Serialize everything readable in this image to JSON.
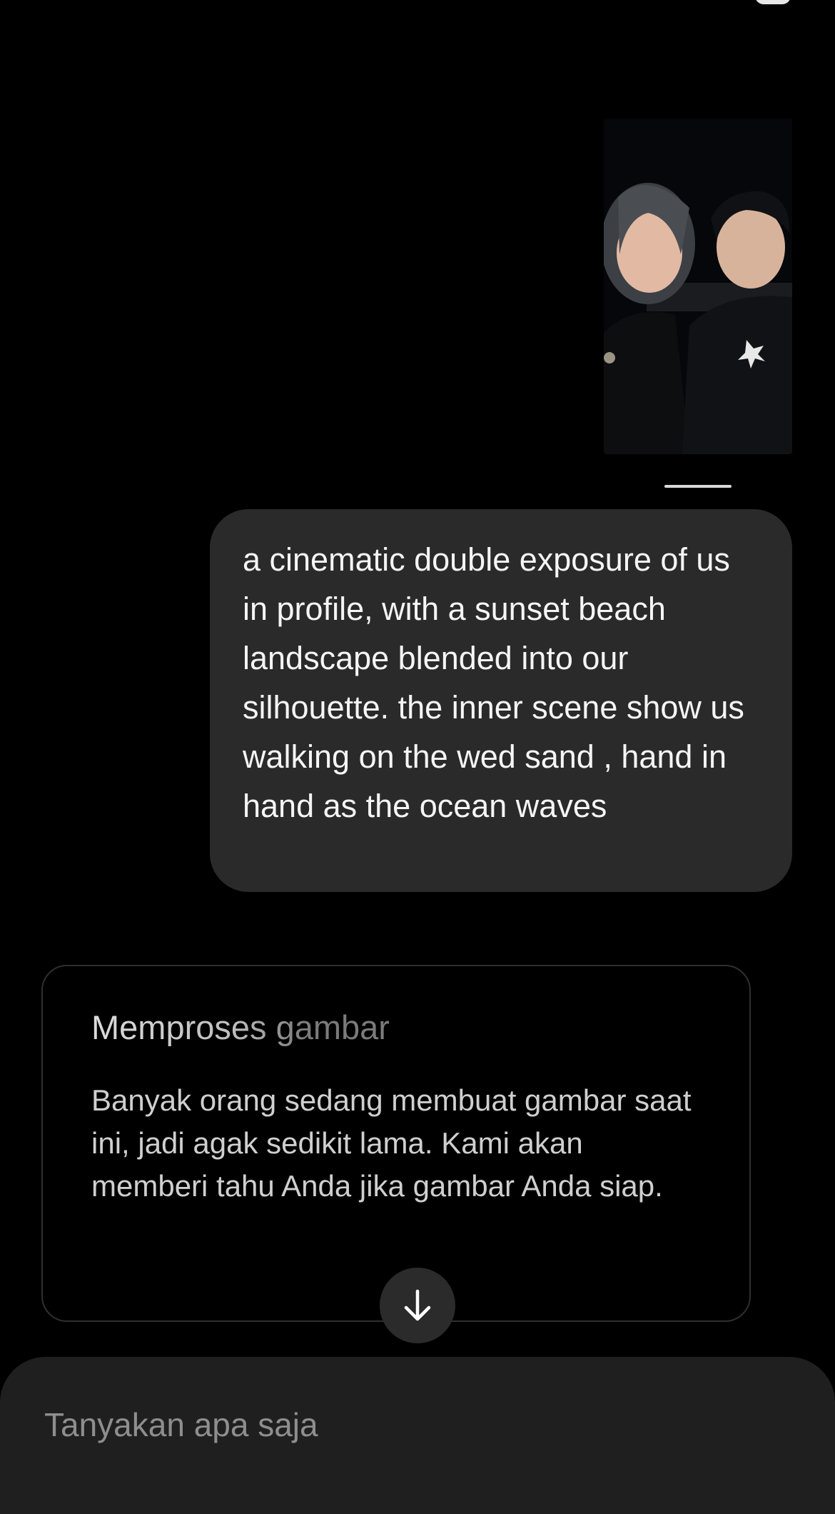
{
  "attachment": {
    "icon": "photo-thumbnail"
  },
  "message": {
    "text": "a cinematic double exposure of us in profile, with a sunset beach landscape blended into our silhouette. the inner scene show us walking on the wed sand , hand in hand as the ocean waves"
  },
  "processing": {
    "title": "Memproses gambar",
    "body": "Banyak orang sedang membuat gambar saat ini, jadi agak sedikit lama. Kami akan memberi tahu Anda jika gambar Anda siap."
  },
  "scroll_button": {
    "icon": "arrow-down-icon"
  },
  "composer": {
    "placeholder": "Tanyakan apa saja"
  },
  "colors": {
    "background": "#000000",
    "bubble": "#2a2a2a",
    "composer": "#1f1f1f",
    "card_border": "#2f2f2f"
  }
}
